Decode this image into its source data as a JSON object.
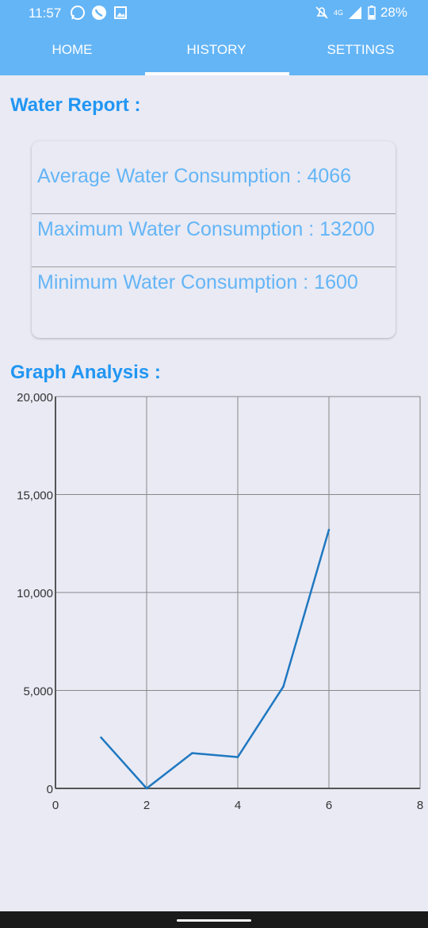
{
  "status": {
    "time": "11:57",
    "network": "4G",
    "battery": "28%"
  },
  "tabs": [
    {
      "label": "HOME"
    },
    {
      "label": "HISTORY"
    },
    {
      "label": "SETTINGS"
    }
  ],
  "report": {
    "title": "Water Report :",
    "average": "Average Water Consumption : 4066",
    "maximum": "Maximum Water Consumption : 13200",
    "minimum": "Minimum Water Consumption : 1600"
  },
  "graph": {
    "title": "Graph Analysis :"
  },
  "colors": {
    "accent": "#2196f3",
    "tabbar": "#64b5f6",
    "line": "#1f78c1"
  },
  "chart_data": {
    "type": "line",
    "x": [
      1,
      2,
      3,
      4,
      5,
      6
    ],
    "series": [
      {
        "values": [
          2600,
          0,
          1800,
          1600,
          5200,
          13200
        ]
      }
    ],
    "xlim": [
      0,
      8
    ],
    "ylim": [
      0,
      20000
    ],
    "x_ticks": [
      0,
      2,
      4,
      6,
      8
    ],
    "y_ticks": [
      0,
      5000,
      10000,
      15000,
      20000
    ],
    "x_tick_labels": [
      "0",
      "2",
      "4",
      "6",
      "8"
    ],
    "y_tick_labels": [
      "0",
      "5,000",
      "10,000",
      "15,000",
      "20,000"
    ],
    "grid": true
  }
}
